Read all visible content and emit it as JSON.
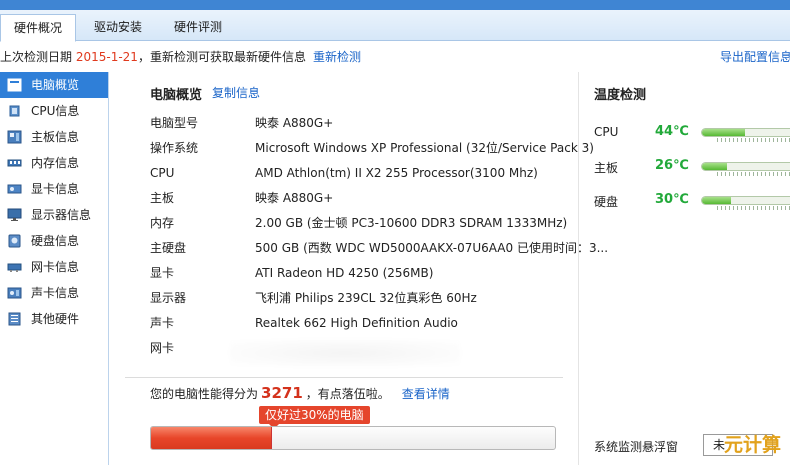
{
  "tabs": [
    {
      "label": "硬件概况"
    },
    {
      "label": "驱动安装"
    },
    {
      "label": "硬件评测"
    }
  ],
  "infobar": {
    "prefix": "上次检测日期 ",
    "date": "2015-1-21",
    "suffix": "，重新检测可获取最新硬件信息",
    "rescan": "重新检测",
    "export": "导出配置信息"
  },
  "sidebar": {
    "items": [
      {
        "label": "电脑概览",
        "icon": "overview-icon"
      },
      {
        "label": "CPU信息",
        "icon": "cpu-icon"
      },
      {
        "label": "主板信息",
        "icon": "motherboard-icon"
      },
      {
        "label": "内存信息",
        "icon": "memory-icon"
      },
      {
        "label": "显卡信息",
        "icon": "graphics-card-icon"
      },
      {
        "label": "显示器信息",
        "icon": "monitor-icon"
      },
      {
        "label": "硬盘信息",
        "icon": "hard-disk-icon"
      },
      {
        "label": "网卡信息",
        "icon": "network-card-icon"
      },
      {
        "label": "声卡信息",
        "icon": "sound-card-icon"
      },
      {
        "label": "其他硬件",
        "icon": "other-hardware-icon"
      }
    ]
  },
  "overview": {
    "title": "电脑概览",
    "copy": "复制信息",
    "rows": [
      {
        "label": "电脑型号",
        "value": "映泰 A880G+"
      },
      {
        "label": "操作系统",
        "value": "Microsoft Windows XP Professional (32位/Service Pack 3)"
      },
      {
        "label": "CPU",
        "value": "AMD Athlon(tm) II X2 255 Processor(3100 Mhz)"
      },
      {
        "label": "主板",
        "value": "映泰 A880G+"
      },
      {
        "label": "内存",
        "value": "2.00 GB (金士顿 PC3-10600 DDR3 SDRAM 1333MHz)"
      },
      {
        "label": "主硬盘",
        "value": "500 GB (西数 WDC WD5000AAKX-07U6AA0 已使用时间：3..."
      },
      {
        "label": "显卡",
        "value": "ATI Radeon HD 4250 (256MB)"
      },
      {
        "label": "显示器",
        "value": "飞利浦 Philips 239CL 32位真彩色 60Hz"
      },
      {
        "label": "声卡",
        "value": "Realtek 662 High Definition Audio"
      },
      {
        "label": "网卡",
        "value": ""
      }
    ]
  },
  "score": {
    "prefix": "您的电脑性能得分为",
    "value": "3271",
    "suffix": "，有点落伍啦。",
    "detail": "查看详情",
    "badge": "仅好过30%的电脑",
    "percent": 30
  },
  "temps": {
    "title": "温度检测",
    "items": [
      {
        "label": "CPU",
        "value": "44℃",
        "level": 0.44
      },
      {
        "label": "主板",
        "value": "26℃",
        "level": 0.26
      },
      {
        "label": "硬盘",
        "value": "30℃",
        "level": 0.3
      }
    ],
    "float_label": "系统监测悬浮窗",
    "float_value": "未"
  },
  "watermark": "元计算",
  "colors": {
    "accent": "#2f7fd8",
    "link": "#1a64c8",
    "score_red": "#d4321c",
    "temp_green": "#22a93a"
  }
}
